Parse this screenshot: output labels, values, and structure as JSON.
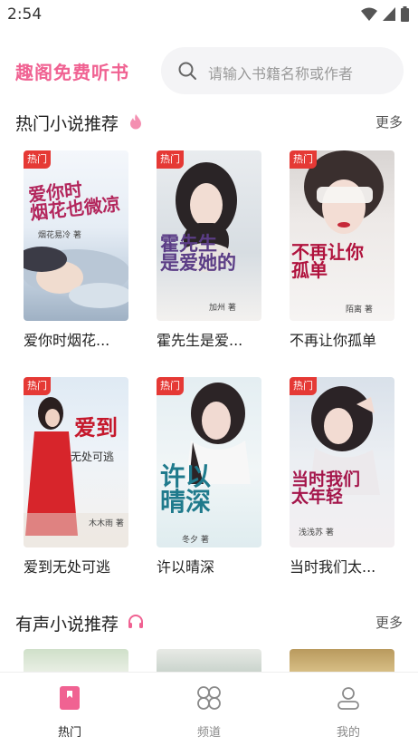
{
  "status_bar": {
    "time": "2:54"
  },
  "header": {
    "app_title": "趣阁免费听书",
    "search_placeholder": "请输入书籍名称或作者"
  },
  "hot_section": {
    "title": "热门小说推荐",
    "more": "更多",
    "books": [
      {
        "badge": "热门",
        "title": "爱你时烟花...",
        "cover_title": "爱你时\n烟花也微凉",
        "cover_author": "烟花易冷 著"
      },
      {
        "badge": "热门",
        "title": "霍先生是爱...",
        "cover_title": "霍先生\n是爱她的",
        "cover_author": "加州 著"
      },
      {
        "badge": "热门",
        "title": "不再让你孤单",
        "cover_title": "不再让你\n孤单",
        "cover_author": "陌离 著"
      },
      {
        "badge": "热门",
        "title": "爱到无处可逃",
        "cover_title": "爱到",
        "cover_subtitle": "无处可逃",
        "cover_author": "木木雨 著"
      },
      {
        "badge": "热门",
        "title": "许以晴深",
        "cover_title": "许以\n晴深",
        "cover_author": "冬夕 著"
      },
      {
        "badge": "热门",
        "title": "当时我们太...",
        "cover_title": "当时我们\n太年轻",
        "cover_author": "浅浅苏 著"
      }
    ]
  },
  "audio_section": {
    "title": "有声小说推荐",
    "more": "更多"
  },
  "bottom_nav": [
    {
      "label": "热门",
      "icon": "bookmark-icon",
      "active": true
    },
    {
      "label": "频道",
      "icon": "grid-icon",
      "active": false
    },
    {
      "label": "我的",
      "icon": "user-icon",
      "active": false
    }
  ],
  "colors": {
    "accent": "#f06292",
    "badge": "#e53935"
  }
}
